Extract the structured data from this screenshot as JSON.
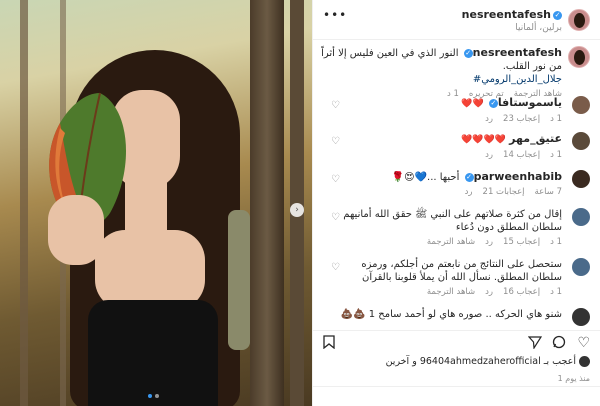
{
  "post": {
    "username": "nesreentafesh",
    "location": "برلين، ألمانيا",
    "more_icon": "more-dots-icon"
  },
  "caption": {
    "username": "nesreentafesh",
    "text": "النور الذي في العين فليس إلا أثراً من نور القلب.",
    "author": "جلال_الدين_الرومي#",
    "edited": "تم تحريره",
    "see_translation": "شاهد الترجمة",
    "age": "1 د"
  },
  "comments": [
    {
      "username": "ياسموستافا",
      "text": "❤️❤️",
      "age": "1 د",
      "likes": "إعجاب 23",
      "reply": "رد",
      "avatar_color": "#7a5c4a"
    },
    {
      "username": "عتيق_مهر",
      "text": "❤️❤️❤️❤️",
      "age": "1 د",
      "likes": "إعجاب 14",
      "reply": "رد",
      "avatar_color": "#5a4a3a"
    },
    {
      "username": "parweenhabib",
      "text": "أحبها ...💙😍🌹",
      "age": "7 ساعة",
      "likes": "إعجابات 21",
      "reply": "رد",
      "avatar_color": "#3a2a20"
    },
    {
      "username": "إقال من كثرة صلاتهم على النبي",
      "text": "إقال من كثرة صلاتهم على النبي ﷺ حقق الله أمانيهم سلطان المطلق دون دُعاء",
      "age": "1 د",
      "likes": "إعجاب 15",
      "reply": "رد",
      "see_translation": "شاهد الترجمة",
      "avatar_color": "#4a6a8a"
    },
    {
      "username": "سلطان المطلق",
      "text": "ستحصل على النتائج من نابعتم من أجلكم، ورمزه سلطان المطلق. نسأل الله أن يملأ قلوبنا بالقرآن",
      "age": "1 د",
      "likes": "إعجاب 16",
      "reply": "رد",
      "see_translation": "شاهد الترجمة",
      "avatar_color": "#4a6a8a"
    },
    {
      "username": "أحمد سامح 1",
      "text": "شنو هاي الحركه .. صوره هاي لو أحمد سامح 1 💩💩",
      "avatar_color": "#333333"
    }
  ],
  "actions": {
    "like_icon": "heart-icon",
    "comment_icon": "comment-icon",
    "share_icon": "share-icon",
    "save_icon": "bookmark-icon"
  },
  "likes_text": "أعجب بـ 96404ahmedzaherofficial و آخرين",
  "date_text": "منذ يوم 1",
  "colors": {
    "accent": "#3897f0",
    "heart": "#ed4956"
  }
}
